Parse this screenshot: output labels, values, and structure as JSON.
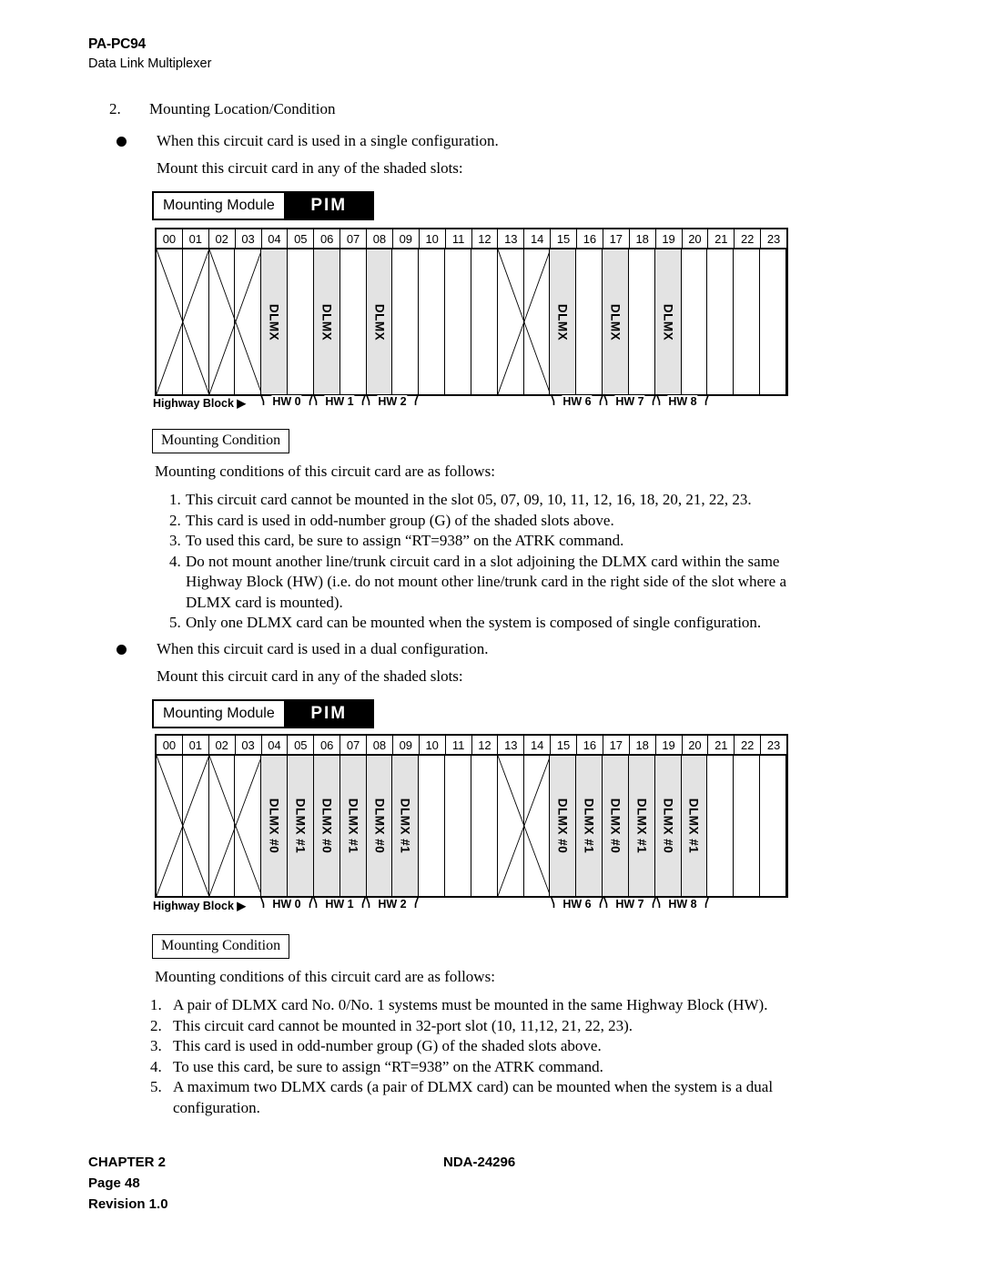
{
  "header": {
    "code": "PA-PC94",
    "subtitle": "Data Link Multiplexer"
  },
  "section": {
    "number": "2.",
    "title": "Mounting Location/Condition"
  },
  "single": {
    "bullet": "When this circuit card is used in a single configuration.",
    "instruction": "Mount this circuit card in any of the shaded slots:",
    "module_label": "Mounting Module",
    "module_type": "PIM",
    "slots": [
      "00",
      "01",
      "02",
      "03",
      "04",
      "05",
      "06",
      "07",
      "08",
      "09",
      "10",
      "11",
      "12",
      "13",
      "14",
      "15",
      "16",
      "17",
      "18",
      "19",
      "20",
      "21",
      "22",
      "23"
    ],
    "shaded_slots": [
      4,
      6,
      8,
      15,
      17,
      19
    ],
    "card_label": "DLMX",
    "card_labels": {
      "4": "DLMX",
      "6": "DLMX",
      "8": "DLMX",
      "15": "DLMX",
      "17": "DLMX",
      "19": "DLMX"
    },
    "x_spans": [
      [
        0,
        1
      ],
      [
        2,
        3
      ],
      [
        13,
        14
      ]
    ],
    "highway_title": "Highway Block",
    "highway_arrow": "▶",
    "highway_groups": [
      {
        "label": "HW 0",
        "start": 4,
        "end": 5
      },
      {
        "label": "HW 1",
        "start": 6,
        "end": 7
      },
      {
        "label": "HW 2",
        "start": 8,
        "end": 9
      },
      {
        "label": "HW 6",
        "start": 15,
        "end": 16
      },
      {
        "label": "HW 7",
        "start": 17,
        "end": 18
      },
      {
        "label": "HW 8",
        "start": 19,
        "end": 20
      }
    ],
    "condition_tag": "Mounting Condition",
    "condition_intro": "Mounting conditions of this circuit card are as follows:",
    "conditions": [
      {
        "n": "1.",
        "lines": [
          "This circuit card cannot be mounted in the slot 05, 07, 09, 10, 11, 12, 16, 18, 20, 21, 22, 23."
        ]
      },
      {
        "n": "2.",
        "lines": [
          "This card is used in odd-number group (G) of the shaded slots above."
        ]
      },
      {
        "n": "3.",
        "lines": [
          "To used this card, be sure to assign “RT=938” on the ATRK command."
        ]
      },
      {
        "n": "4.",
        "lines": [
          "Do not mount another line/trunk circuit card in a slot adjoining the DLMX card within the same",
          "Highway Block (HW) (i.e. do not mount other line/trunk card in the right side of the slot where a",
          "DLMX card is mounted)."
        ]
      },
      {
        "n": "5.",
        "lines": [
          "Only one DLMX card can be mounted when the system is composed of single configuration."
        ]
      }
    ]
  },
  "dual": {
    "bullet": "When this circuit card is used in a dual configuration.",
    "instruction": "Mount this circuit card in any of the shaded slots:",
    "module_label": "Mounting Module",
    "module_type": "PIM",
    "slots": [
      "00",
      "01",
      "02",
      "03",
      "04",
      "05",
      "06",
      "07",
      "08",
      "09",
      "10",
      "11",
      "12",
      "13",
      "14",
      "15",
      "16",
      "17",
      "18",
      "19",
      "20",
      "21",
      "22",
      "23"
    ],
    "shaded_slots": [
      4,
      5,
      6,
      7,
      8,
      9,
      15,
      16,
      17,
      18,
      19,
      20
    ],
    "card_labels": {
      "4": "DLMX #0",
      "5": "DLMX #1",
      "6": "DLMX #0",
      "7": "DLMX #1",
      "8": "DLMX #0",
      "9": "DLMX #1",
      "15": "DLMX #0",
      "16": "DLMX #1",
      "17": "DLMX #0",
      "18": "DLMX #1",
      "19": "DLMX #0",
      "20": "DLMX #1"
    },
    "x_spans": [
      [
        0,
        1
      ],
      [
        2,
        3
      ],
      [
        13,
        14
      ]
    ],
    "highway_title": "Highway Block",
    "highway_arrow": "▶",
    "highway_groups": [
      {
        "label": "HW 0",
        "start": 4,
        "end": 5
      },
      {
        "label": "HW 1",
        "start": 6,
        "end": 7
      },
      {
        "label": "HW 2",
        "start": 8,
        "end": 9
      },
      {
        "label": "HW 6",
        "start": 15,
        "end": 16
      },
      {
        "label": "HW 7",
        "start": 17,
        "end": 18
      },
      {
        "label": "HW 8",
        "start": 19,
        "end": 20
      }
    ],
    "condition_tag": "Mounting Condition",
    "condition_intro": "Mounting conditions of this circuit card are as follows:",
    "conditions": [
      {
        "n": "1.",
        "lines": [
          "A pair of DLMX card No. 0/No. 1 systems must be mounted in the same Highway Block (HW)."
        ]
      },
      {
        "n": "2.",
        "lines": [
          "This circuit card cannot be mounted in 32-port slot (10, 11,12, 21, 22, 23)."
        ]
      },
      {
        "n": "3.",
        "lines": [
          "This card is used in odd-number group (G) of the shaded slots above."
        ]
      },
      {
        "n": "4.",
        "lines": [
          "To use this card, be sure to assign “RT=938” on the ATRK command."
        ]
      },
      {
        "n": "5.",
        "lines": [
          "A maximum two DLMX cards (a pair of DLMX card) can be mounted when the system is a dual",
          "configuration."
        ]
      }
    ]
  },
  "footer": {
    "chapter": "CHAPTER 2",
    "doc": "NDA-24296",
    "page": "Page 48",
    "revision": "Revision 1.0"
  }
}
